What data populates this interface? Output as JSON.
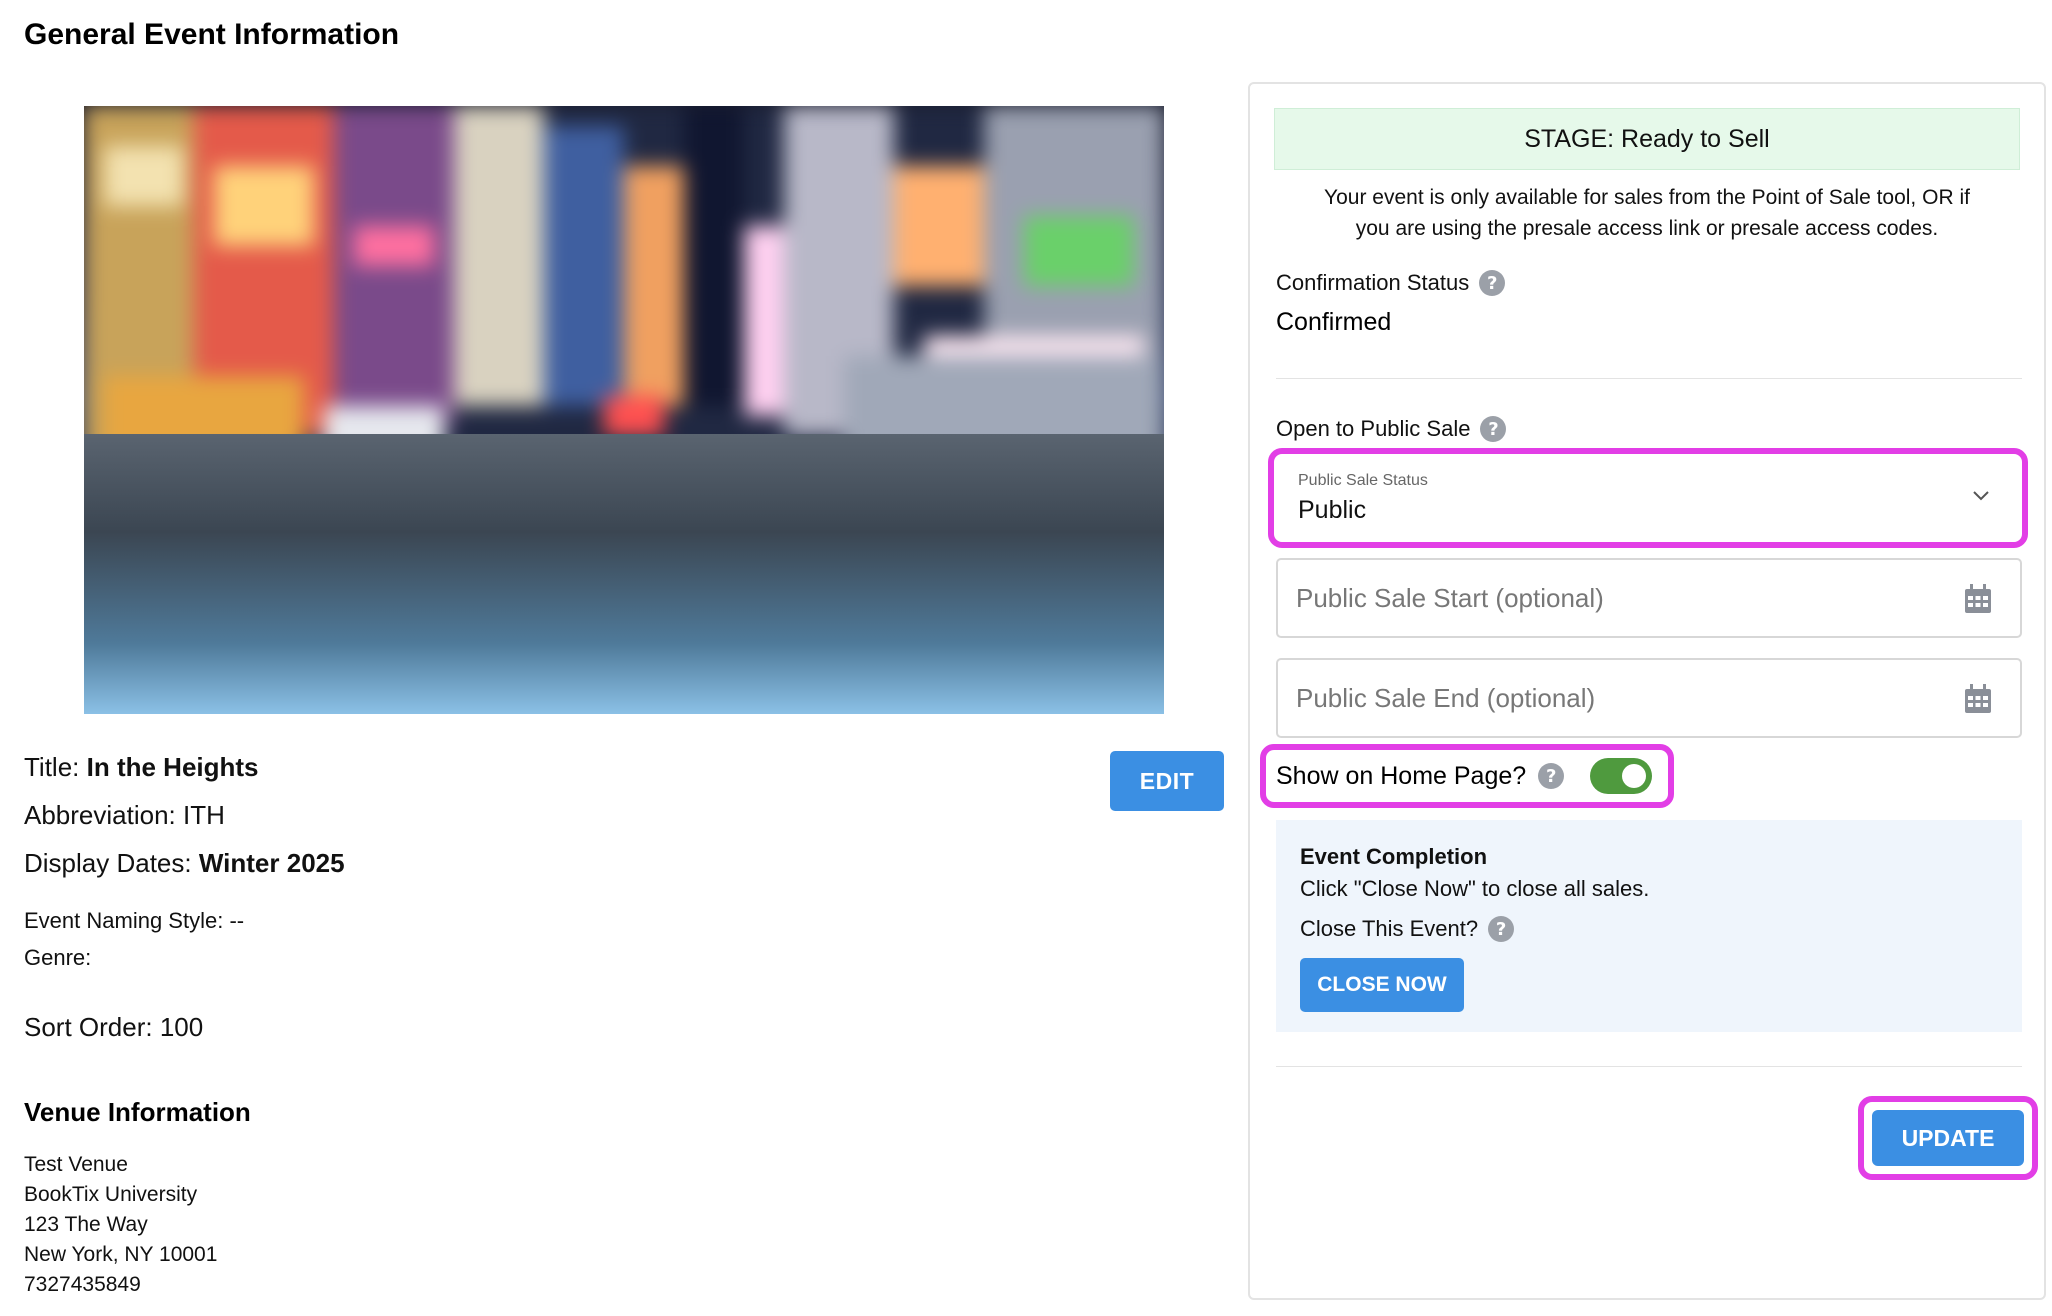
{
  "page": {
    "title": "General Event Information"
  },
  "event_info": {
    "title_label": "Title:",
    "title_value": "In the Heights",
    "abbrev_label": "Abbreviation:",
    "abbrev_value": "ITH",
    "dates_label": "Display Dates:",
    "dates_value": "Winter 2025",
    "naming_label": "Event Naming Style:",
    "naming_value": "--",
    "genre_label": "Genre:",
    "genre_value": "",
    "sort_label": "Sort Order:",
    "sort_value": "100",
    "edit_label": "EDIT"
  },
  "venue": {
    "heading": "Venue Information",
    "name": "Test Venue",
    "org": "BookTix University",
    "street": "123 The Way",
    "city": "New York, NY 10001",
    "phone": "7327435849"
  },
  "status_panel": {
    "stage": "STAGE: Ready to Sell",
    "stage_desc_1": "Your event is only available for sales from the Point of Sale tool, OR if",
    "stage_desc_2": "you are using the presale access link or presale access codes.",
    "confirmation_label": "Confirmation Status",
    "confirmation_value": "Confirmed",
    "open_public_label": "Open to Public Sale",
    "public_status_label": "Public Sale Status",
    "public_status_value": "Public",
    "sale_start_placeholder": "Public Sale Start (optional)",
    "sale_end_placeholder": "Public Sale End (optional)",
    "home_page_label": "Show on Home Page?",
    "home_page_enabled": true,
    "completion_title": "Event Completion",
    "completion_desc": "Click \"Close Now\" to close all sales.",
    "close_question": "Close This Event?",
    "close_now_label": "CLOSE NOW",
    "update_label": "UPDATE"
  },
  "colors": {
    "primary_button": "#3b8fe3",
    "highlight": "#e23ee6",
    "stage_bg": "#e6f9ea",
    "toggle_on": "#4f9a3e",
    "completion_bg": "#eff5fc"
  }
}
